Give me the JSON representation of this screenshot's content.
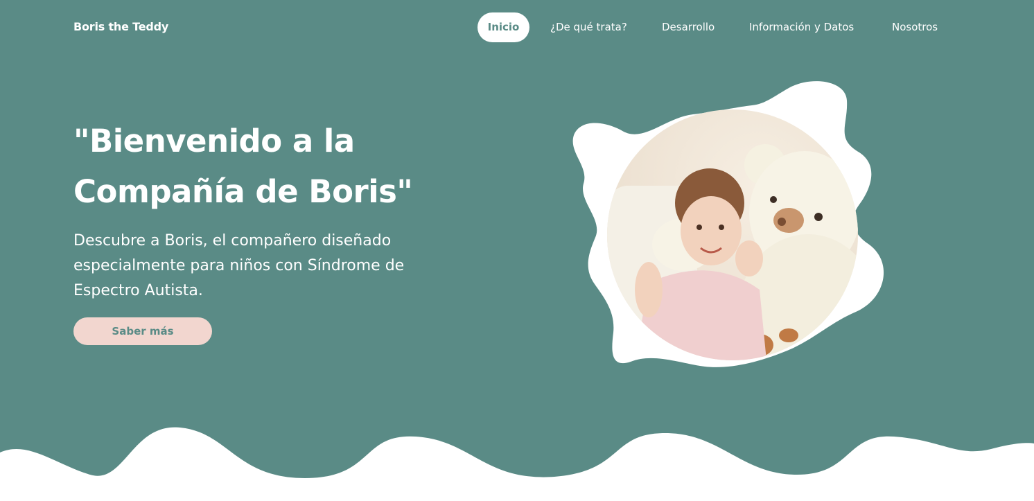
{
  "brand": "Boris the Teddy",
  "nav": {
    "items": [
      {
        "label": "Inicio",
        "active": true
      },
      {
        "label": "¿De qué trata?",
        "active": false
      },
      {
        "label": "Desarrollo",
        "active": false
      },
      {
        "label": "Información y Datos",
        "active": false
      },
      {
        "label": "Nosotros",
        "active": false
      }
    ]
  },
  "hero": {
    "title_line1": "\"Bienvenido a la",
    "title_line2": "Compañía de Boris\"",
    "description_line1": "Descubre a Boris, el compañero diseñado",
    "description_line2": "especialmente para niños con Síndrome de",
    "description_line3": "Espectro Autista.",
    "cta_label": "Saber más"
  },
  "colors": {
    "background": "#5a8b86",
    "white": "#ffffff",
    "cta_bg": "#f2d6cf"
  }
}
